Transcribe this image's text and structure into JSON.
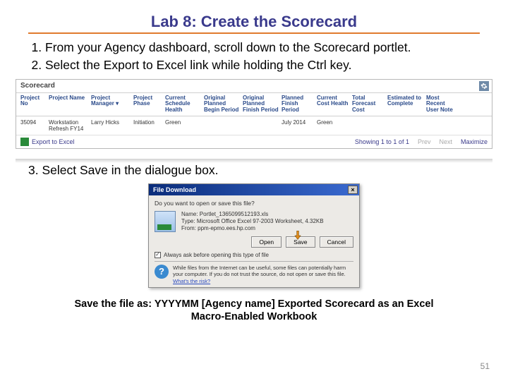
{
  "title": "Lab 8: Create the Scorecard",
  "steps": {
    "s1": "From your Agency dashboard, scroll down to the Scorecard portlet.",
    "s2": "Select the Export to Excel link while holding the Ctrl key.",
    "s3": "3. Select Save in the dialogue box."
  },
  "scorecard": {
    "title": "Scorecard",
    "headers": {
      "h0": "Project No",
      "h1": "Project Name",
      "h2": "Project Manager ▾",
      "h3": "Project Phase",
      "h4": "Current Schedule Health",
      "h5": "Original Planned Begin Period",
      "h6": "Original Planned Finish Period",
      "h7": "Planned Finish Period",
      "h8": "Current Cost Health",
      "h9": "Total Forecast Cost",
      "h10": "Estimated to Complete",
      "h11": "Most Recent User Note"
    },
    "row": {
      "c0": "35094",
      "c1": "Workstation Refresh FY14",
      "c2": "Larry Hicks",
      "c3": "Initiation",
      "c4": "Green",
      "c5": "",
      "c6": "",
      "c7": "July 2014",
      "c8": "Green",
      "c9": "",
      "c10": "",
      "c11": ""
    },
    "footer": {
      "export": "Export to Excel",
      "showing": "Showing 1 to 1 of 1",
      "prev": "Prev",
      "next": "Next",
      "max": "Maximize"
    }
  },
  "dialog": {
    "title": "File Download",
    "question": "Do you want to open or save this file?",
    "name_label": "Name:",
    "name_value": "Portlet_1365099512193.xls",
    "type_label": "Type:",
    "type_value": "Microsoft Office Excel 97-2003 Worksheet, 4.32KB",
    "from_label": "From:",
    "from_value": "ppm-epmo.ees.hp.com",
    "open": "Open",
    "save": "Save",
    "cancel": "Cancel",
    "always": "Always ask before opening this type of file",
    "warn1": "While files from the Internet can be useful, some files can potentially harm your computer. If you do not trust the source, do not open or save this file.",
    "warn_link": "What's the risk?"
  },
  "savetext": "Save the file as: YYYYMM [Agency name] Exported Scorecard as an Excel Macro-Enabled Workbook",
  "page": "51"
}
